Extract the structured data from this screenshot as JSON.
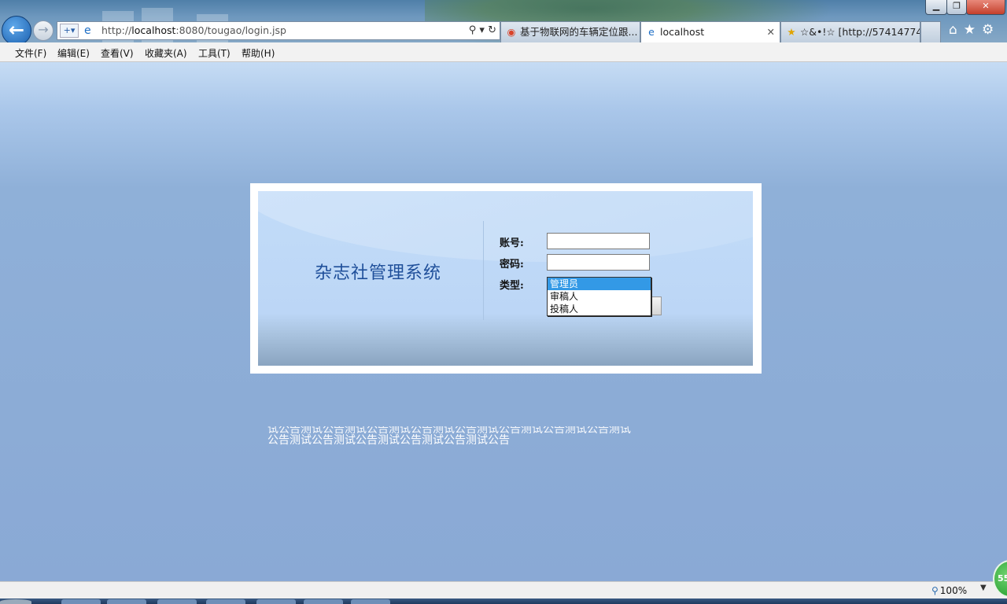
{
  "browser": {
    "url_prefix": "http://",
    "url_host": "localhost",
    "url_rest": ":8080/tougao/login.jsp",
    "tabs": [
      {
        "label": "基于物联网的车辆定位跟..."
      },
      {
        "label": "localhost"
      },
      {
        "label": "☆&•!☆ [http://57414774..."
      }
    ],
    "window_controls": {
      "minimize": "▁",
      "restore": "❐",
      "close": "✕"
    },
    "close_tab": "✕"
  },
  "menu": {
    "file": "文件(F)",
    "edit": "编辑(E)",
    "view": "查看(V)",
    "favorites": "收藏夹(A)",
    "tools": "工具(T)",
    "help": "帮助(H)"
  },
  "login": {
    "system_title": "杂志社管理系统",
    "account_label": "账号:",
    "password_label": "密码:",
    "type_label": "类型:",
    "account_value": "",
    "password_value": "",
    "type_options": [
      "管理员",
      "审稿人",
      "投稿人"
    ],
    "type_selected": "管理员"
  },
  "notice": {
    "line_partial": "试公告测试公告测试公告测试公告测试公告测试公告测试公告测试公告测试",
    "line_full": "公告测试公告测试公告测试公告测试公告测试公告"
  },
  "status": {
    "zoom": "100%"
  },
  "badge": {
    "value": "55"
  }
}
